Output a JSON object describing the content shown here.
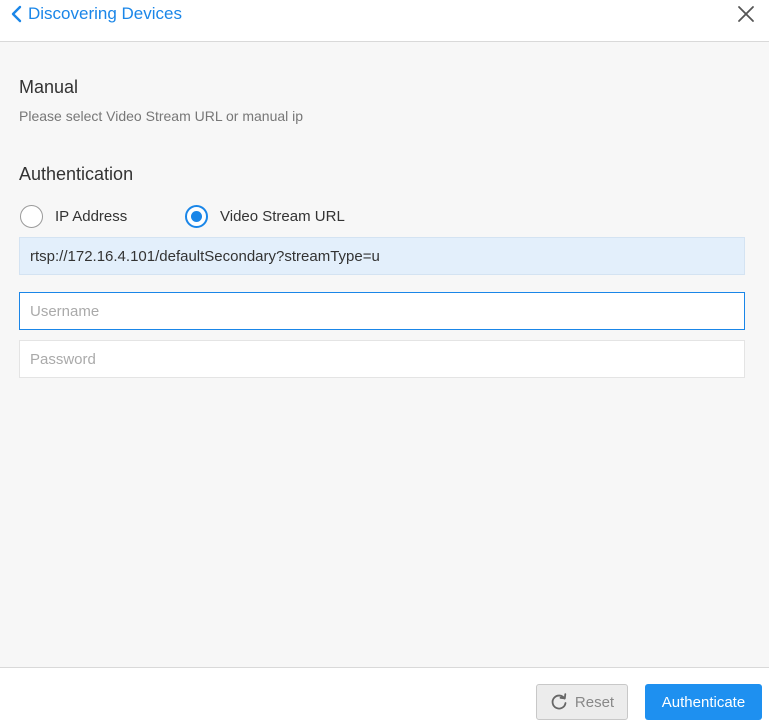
{
  "header": {
    "back_label": "Discovering Devices",
    "back_icon": "chevron-left-icon",
    "close_icon": "close-icon"
  },
  "manual": {
    "title": "Manual",
    "hint": "Please select Video Stream URL or manual ip"
  },
  "authentication": {
    "title": "Authentication",
    "options": [
      {
        "label": "IP Address",
        "checked": false
      },
      {
        "label": "Video Stream URL",
        "checked": true
      }
    ],
    "stream_url": "rtsp://172.16.4.101/defaultSecondary?streamType=u",
    "username_placeholder": "Username",
    "password_placeholder": "Password"
  },
  "footer": {
    "reset_label": "Reset",
    "reset_icon": "refresh-icon",
    "authenticate_label": "Authenticate"
  },
  "colors": {
    "accent": "#1a86e8",
    "primary_button": "#1e90f0",
    "url_field_bg": "#e3effb"
  }
}
